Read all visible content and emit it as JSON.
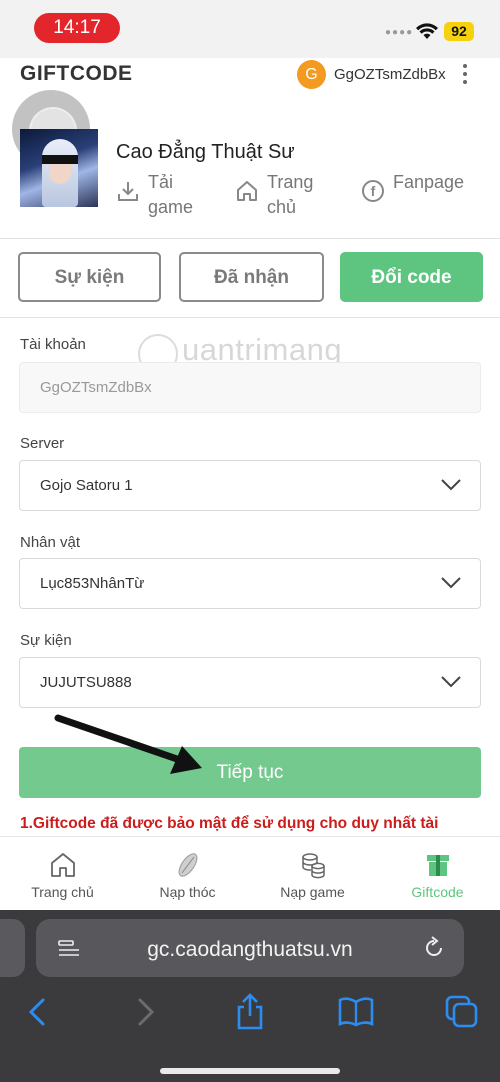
{
  "status_bar": {
    "time": "14:17",
    "battery": "92",
    "colors": {
      "time_pill": "#e2262b",
      "battery": "#f6d20e"
    }
  },
  "header": {
    "logo": "GIFTCODE",
    "avatar_letter": "G",
    "username": "GgOZTsmZdbBx"
  },
  "game": {
    "title": "Cao Đẳng Thuật Sư",
    "links": [
      {
        "line1": "Tải",
        "line2": "game",
        "icon": "download-icon"
      },
      {
        "line1": "Trang",
        "line2": "chủ",
        "icon": "home-icon"
      },
      {
        "line1": "Fanpage",
        "line2": "",
        "icon": "facebook-icon"
      }
    ]
  },
  "tabs": [
    {
      "label": "Sự kiện",
      "active": false
    },
    {
      "label": "Đã nhận",
      "active": false
    },
    {
      "label": "Đổi code",
      "active": true
    }
  ],
  "form": {
    "account": {
      "label": "Tài khoản",
      "value": "GgOZTsmZdbBx"
    },
    "server": {
      "label": "Server",
      "value": "Gojo Satoru 1"
    },
    "character": {
      "label": "Nhân vật",
      "value": "Lục853NhânTừ"
    },
    "event": {
      "label": "Sự kiện",
      "value": "JUJUTSU888"
    },
    "submit_label": "Tiếp tục"
  },
  "watermark": "uantrimang",
  "note": "1.Giftcode đã được bảo mật để sử dụng cho duy nhất tài",
  "bottom_nav": [
    {
      "label": "Trang chủ",
      "icon": "home-icon"
    },
    {
      "label": "Nạp thóc",
      "icon": "grain-icon"
    },
    {
      "label": "Nạp game",
      "icon": "coins-icon"
    },
    {
      "label": "Giftcode",
      "icon": "gift-box-icon",
      "active": true
    }
  ],
  "browser": {
    "url": "gc.caodangthuatsu.vn"
  },
  "colors": {
    "accent_green": "#5ec580",
    "button_green": "#74c98e",
    "note_red": "#cc1c1c",
    "safari_bg": "#3b3b3d"
  }
}
